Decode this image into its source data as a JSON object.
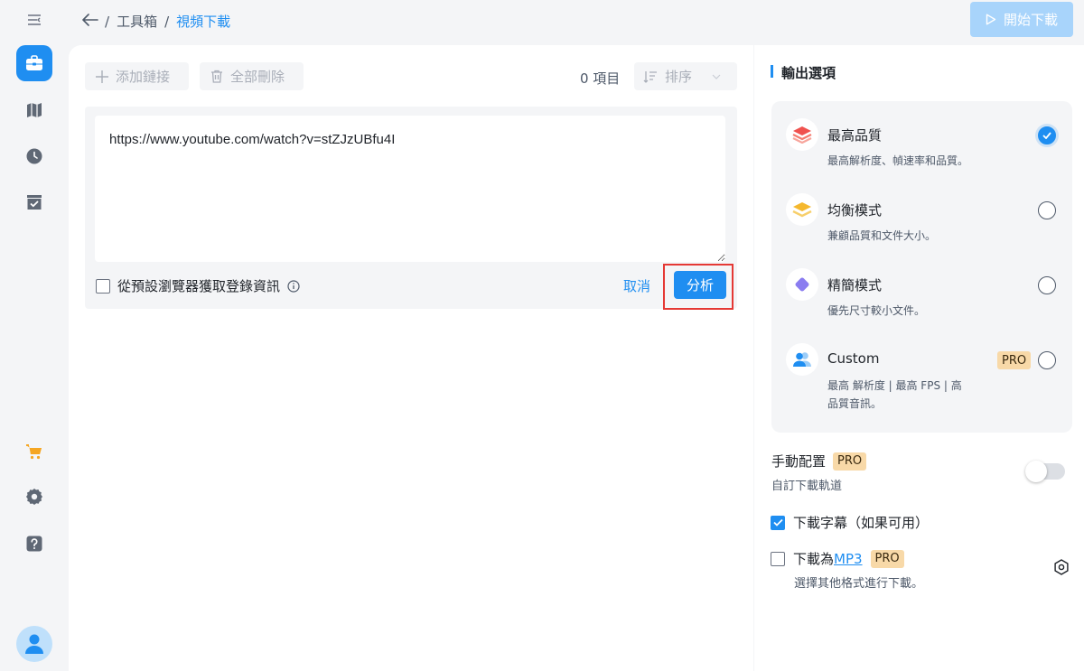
{
  "header": {
    "breadcrumbs": [
      "工具箱",
      "視頻下載"
    ],
    "separator": "/",
    "start_button": "開始下載"
  },
  "toolbar": {
    "add_link": "添加鏈接",
    "delete_all": "全部刪除",
    "item_count": "0 項目",
    "sort": "排序"
  },
  "input": {
    "url": "https://www.youtube.com/watch?v=stZJzUBfu4I",
    "login_checkbox_label": "從預設瀏覽器獲取登錄資訊",
    "login_checked": false,
    "cancel": "取消",
    "analyze": "分析"
  },
  "output": {
    "title": "輸出選項",
    "options": [
      {
        "title": "最高品質",
        "desc": "最高解析度、幀速率和品質。",
        "selected": true,
        "icon": "layers-red-icon"
      },
      {
        "title": "均衡模式",
        "desc": "兼顧品質和文件大小。",
        "selected": false,
        "icon": "layers-yellow-icon"
      },
      {
        "title": "精簡模式",
        "desc": "優先尺寸較小文件。",
        "selected": false,
        "icon": "diamond-purple-icon"
      },
      {
        "title": "Custom",
        "desc": "最高 解析度 | 最高 FPS | 高品質音訊。",
        "selected": false,
        "icon": "users-blue-icon",
        "pro": "PRO"
      }
    ],
    "manual_config": {
      "title": "手動配置",
      "pro": "PRO",
      "desc": "自訂下載軌道",
      "enabled": false
    },
    "subtitles": {
      "label": "下載字幕（如果可用）",
      "checked": true
    },
    "mp3": {
      "prefix": "下載為",
      "link": "MP3",
      "pro": "PRO",
      "desc": "選擇其他格式進行下載。",
      "checked": false
    }
  },
  "colors": {
    "accent": "#1f8ef1",
    "pro_badge": "#f8d9a8",
    "highlight_box": "#e53935"
  }
}
